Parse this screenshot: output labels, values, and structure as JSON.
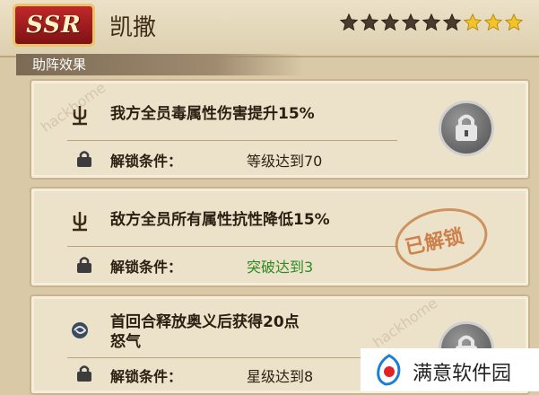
{
  "header": {
    "rarity": "SSR",
    "hero_name": "凯撒",
    "stars_filled": 6,
    "stars_total": 9
  },
  "section_title": "助阵效果",
  "cards": [
    {
      "effect": "我方全员毒属性伤害提升15%",
      "cond_label": "解锁条件：",
      "cond_value": "等级达到70",
      "status": "locked"
    },
    {
      "effect": "敌方全员所有属性抗性降低15%",
      "cond_label": "解锁条件：",
      "cond_value": "突破达到3",
      "status": "unlocked",
      "stamp": "已解锁"
    },
    {
      "effect_line1": "首回合释放奥义后获得20点",
      "effect_line2": "怒气",
      "cond_label": "解锁条件：",
      "cond_value": "星级达到8",
      "status": "locked"
    }
  ],
  "watermark": "hackhome",
  "brand": "满意软件园",
  "colors": {
    "ssr_badge": "#a81c1e",
    "unlocked_value": "#2f8a24",
    "stamp": "#c86e32"
  }
}
